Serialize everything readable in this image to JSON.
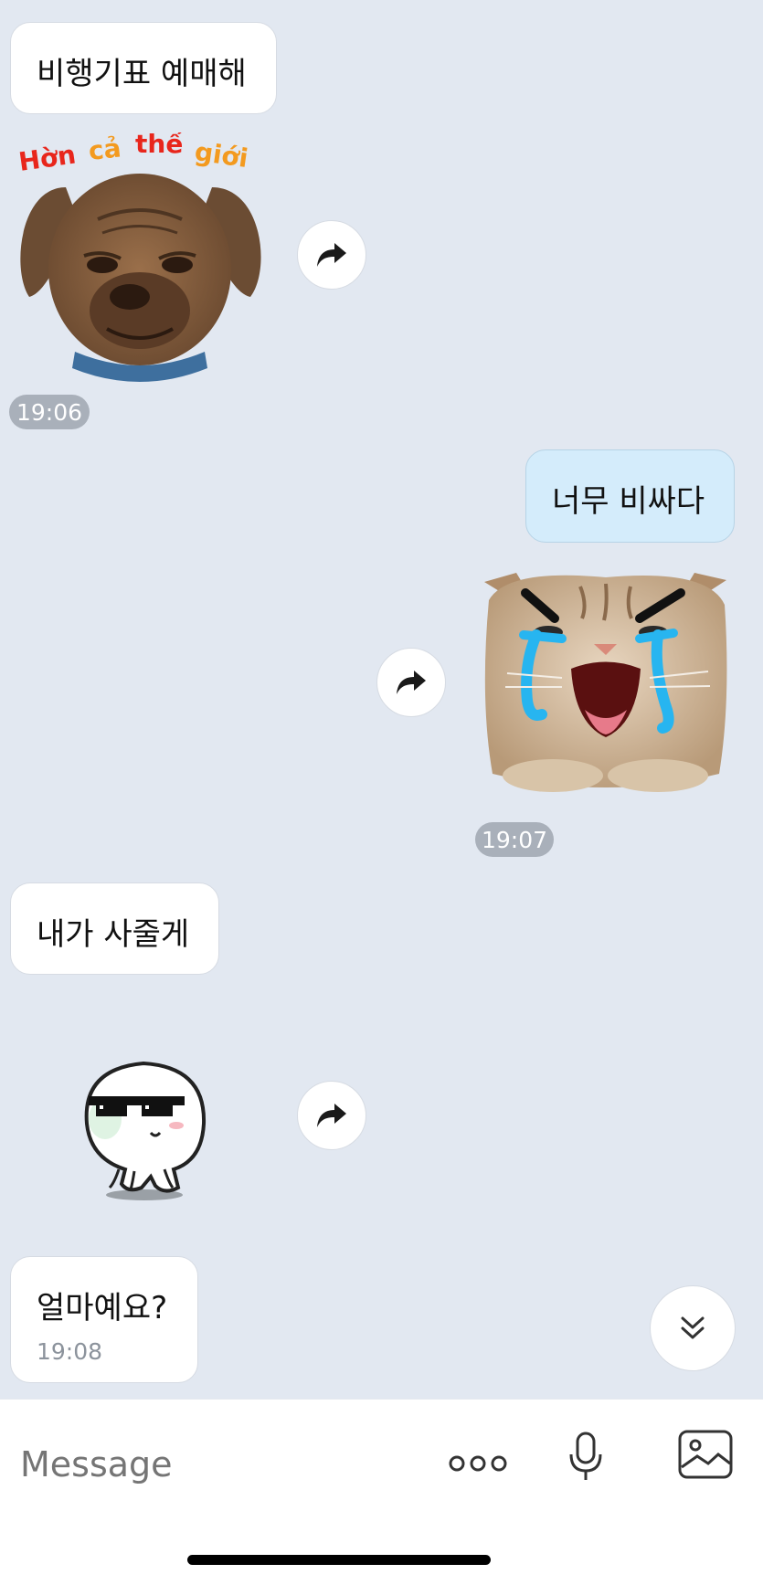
{
  "messages": {
    "m1": {
      "text": "비행기표 예매해"
    },
    "ts1": "19:06",
    "m2": {
      "text": "너무 비싸다"
    },
    "ts2": "19:07",
    "m3": {
      "text": "내가 사줄게"
    },
    "m4": {
      "text": "얼마예요?",
      "time": "19:08"
    }
  },
  "stickers": {
    "dog": {
      "caption": "Hờn cả thế giới",
      "icon": "grumpy-dog-sticker"
    },
    "cat": {
      "icon": "crying-cat-sticker"
    },
    "blob": {
      "icon": "sunglasses-blob-sticker"
    }
  },
  "composer": {
    "placeholder": "Message"
  },
  "icons": {
    "share": "share-arrow-icon",
    "more": "more-dots-icon",
    "mic": "microphone-icon",
    "gallery": "gallery-icon",
    "scroll": "chevron-double-down-icon"
  },
  "colors": {
    "background": "#e2e8f1",
    "incoming_bubble": "#ffffff",
    "outgoing_bubble": "#d4ecfb",
    "timestamp_pill": "#a9b0ba"
  }
}
